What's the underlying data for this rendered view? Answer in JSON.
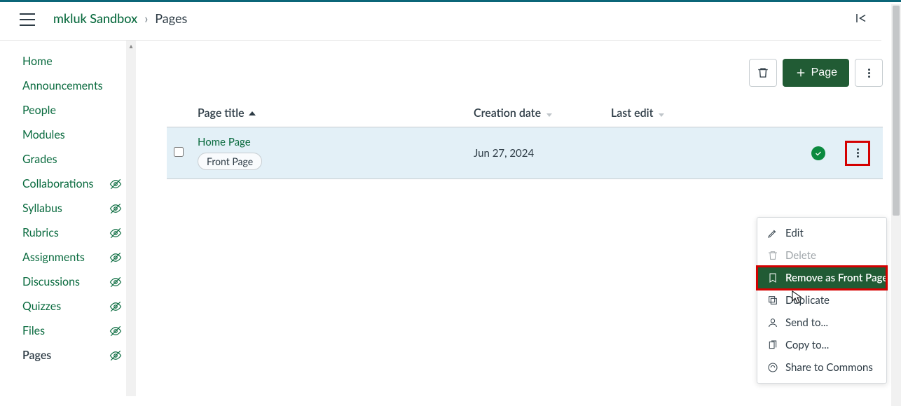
{
  "breadcrumb": {
    "course": "mkluk Sandbox",
    "page": "Pages"
  },
  "sidebar": {
    "items": [
      {
        "label": "Home",
        "hidden": false
      },
      {
        "label": "Announcements",
        "hidden": false
      },
      {
        "label": "People",
        "hidden": false
      },
      {
        "label": "Modules",
        "hidden": false
      },
      {
        "label": "Grades",
        "hidden": false
      },
      {
        "label": "Collaborations",
        "hidden": true
      },
      {
        "label": "Syllabus",
        "hidden": true
      },
      {
        "label": "Rubrics",
        "hidden": true
      },
      {
        "label": "Assignments",
        "hidden": true
      },
      {
        "label": "Discussions",
        "hidden": true
      },
      {
        "label": "Quizzes",
        "hidden": true
      },
      {
        "label": "Files",
        "hidden": true
      },
      {
        "label": "Pages",
        "hidden": true,
        "active": true
      }
    ]
  },
  "toolbar": {
    "add_page_label": "Page"
  },
  "table": {
    "headers": {
      "title": "Page title",
      "creation": "Creation date",
      "last_edit": "Last edit"
    },
    "rows": [
      {
        "title": "Home Page",
        "badge": "Front Page",
        "created": "Jun 27, 2024",
        "last_edit": "",
        "published": true
      }
    ]
  },
  "menu": {
    "edit": "Edit",
    "delete": "Delete",
    "remove_front": "Remove as Front Page",
    "duplicate": "Duplicate",
    "send_to": "Send to...",
    "copy_to": "Copy to...",
    "share_commons": "Share to Commons"
  }
}
